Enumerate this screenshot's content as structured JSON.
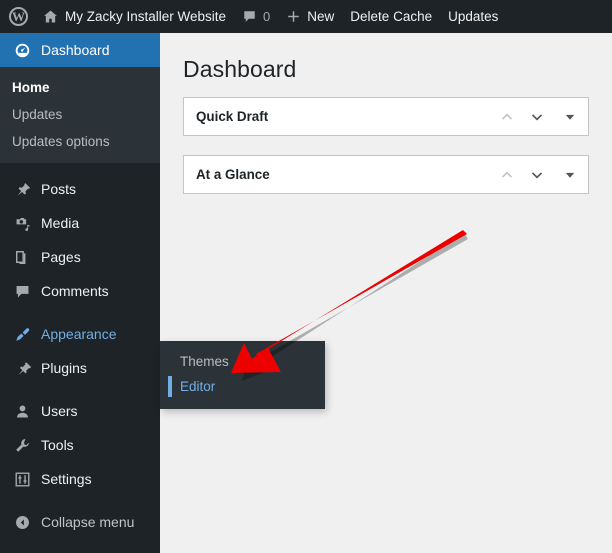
{
  "adminbar": {
    "logo_icon": "wordpress-logo-icon",
    "home_icon": "home-icon",
    "site_name": "My Zacky Installer Website",
    "comments_icon": "comment-bubble-icon",
    "comments_count": "0",
    "new_icon": "plus-icon",
    "new_label": "New",
    "delete_cache_label": "Delete Cache",
    "updates_label": "Updates"
  },
  "sidebar": {
    "items": [
      {
        "label": "Dashboard",
        "icon": "dashboard-icon",
        "state": "current"
      },
      {
        "label": "Posts",
        "icon": "pin-icon",
        "state": "normal"
      },
      {
        "label": "Media",
        "icon": "media-camera-icon",
        "state": "normal"
      },
      {
        "label": "Pages",
        "icon": "pages-icon",
        "state": "normal"
      },
      {
        "label": "Comments",
        "icon": "comment-bubble-icon",
        "state": "normal"
      },
      {
        "label": "Appearance",
        "icon": "paint-brush-icon",
        "state": "hovered"
      },
      {
        "label": "Plugins",
        "icon": "plug-icon",
        "state": "normal"
      },
      {
        "label": "Users",
        "icon": "user-icon",
        "state": "normal"
      },
      {
        "label": "Tools",
        "icon": "wrench-icon",
        "state": "normal"
      },
      {
        "label": "Settings",
        "icon": "sliders-icon",
        "state": "normal"
      },
      {
        "label": "Collapse menu",
        "icon": "collapse-arrow-icon",
        "state": "collapse"
      }
    ],
    "dashboard_submenu": [
      {
        "label": "Home",
        "active": true
      },
      {
        "label": "Updates",
        "active": false
      },
      {
        "label": "Updates options",
        "active": false
      }
    ],
    "appearance_flyout": [
      {
        "label": "Themes",
        "active": false
      },
      {
        "label": "Editor",
        "active": true
      }
    ]
  },
  "main": {
    "page_title": "Dashboard",
    "boxes": [
      {
        "title": "Quick Draft",
        "order_up_icon": "chevron-up-icon",
        "order_down_icon": "chevron-down-icon",
        "toggle_icon": "triangle-down-icon"
      },
      {
        "title": "At a Glance",
        "order_up_icon": "chevron-up-icon",
        "order_down_icon": "chevron-down-icon",
        "toggle_icon": "triangle-down-icon"
      }
    ]
  },
  "annotation": {
    "arrow_color": "#ee0000",
    "arrow_target": "Editor"
  },
  "colors": {
    "adminbar_bg": "#1d2327",
    "sidebar_bg": "#1d2327",
    "submenu_bg": "#2c3338",
    "current_blue": "#2271b1",
    "hover_blue": "#72aee6",
    "content_bg": "#f0f0f1"
  }
}
